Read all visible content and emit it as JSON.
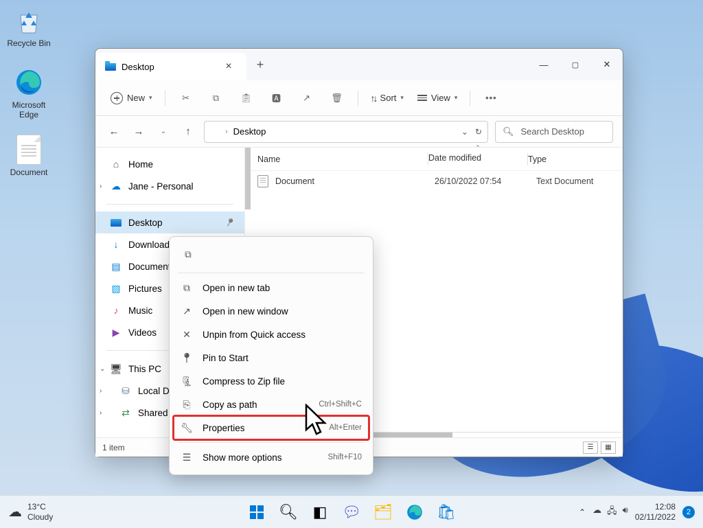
{
  "desktop": {
    "icons": {
      "recycle": "Recycle Bin",
      "edge": "Microsoft Edge",
      "document": "Document"
    }
  },
  "window": {
    "tab_title": "Desktop",
    "toolbar": {
      "new": "New",
      "sort": "Sort",
      "view": "View"
    },
    "address": {
      "current": "Desktop"
    },
    "search": {
      "placeholder": "Search Desktop"
    },
    "sidebar": {
      "home": "Home",
      "user": "Jane - Personal",
      "quick": {
        "desktop": "Desktop",
        "downloads": "Downloads",
        "documents": "Documents",
        "pictures": "Pictures",
        "music": "Music",
        "videos": "Videos"
      },
      "pc": {
        "label": "This PC",
        "local": "Local Dis",
        "shared": "Shared Fo"
      }
    },
    "columns": {
      "name": "Name",
      "date": "Date modified",
      "type": "Type"
    },
    "files": [
      {
        "name": "Document",
        "date": "26/10/2022 07:54",
        "type": "Text Document"
      }
    ],
    "status": "1 item"
  },
  "context_menu": {
    "open_tab": "Open in new tab",
    "open_window": "Open in new window",
    "unpin": "Unpin from Quick access",
    "pin_start": "Pin to Start",
    "compress": "Compress to Zip file",
    "copy_path": {
      "label": "Copy as path",
      "shortcut": "Ctrl+Shift+C"
    },
    "properties": {
      "label": "Properties",
      "shortcut": "Alt+Enter"
    },
    "more": {
      "label": "Show more options",
      "shortcut": "Shift+F10"
    }
  },
  "taskbar": {
    "weather": {
      "temp": "13°C",
      "cond": "Cloudy"
    },
    "clock": {
      "time": "12:08",
      "date": "02/11/2022"
    },
    "notif_count": "2"
  }
}
